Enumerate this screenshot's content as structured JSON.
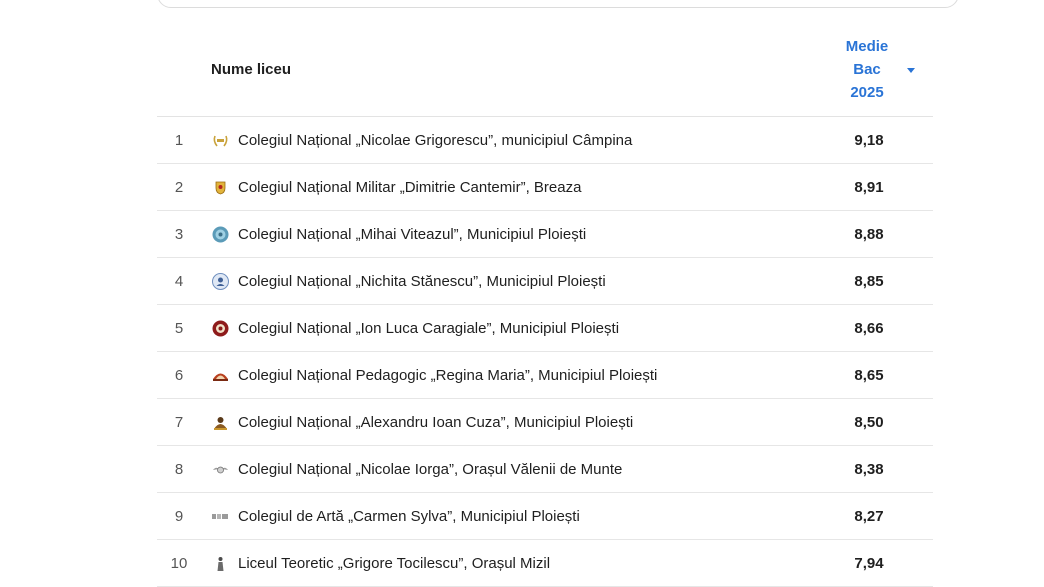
{
  "table": {
    "header": {
      "name_label": "Nume liceu",
      "score_label_line1": "Medie",
      "score_label_line2": "Bac",
      "score_label_line3": "2025"
    },
    "rows": [
      {
        "rank": "1",
        "name": "Colegiul Național „Nicolae Grigorescu”, municipiul Câmpina",
        "score": "9,18",
        "logo": "laurel-crest-icon"
      },
      {
        "rank": "2",
        "name": "Colegiul Național Militar „Dimitrie Cantemir”, Breaza",
        "score": "8,91",
        "logo": "military-shield-icon"
      },
      {
        "rank": "3",
        "name": "Colegiul Național „Mihai Viteazul”, Municipiul Ploiești",
        "score": "8,88",
        "logo": "round-seal-icon"
      },
      {
        "rank": "4",
        "name": "Colegiul Național „Nichita Stănescu”, Municipiul Ploiești",
        "score": "8,85",
        "logo": "portrait-seal-icon"
      },
      {
        "rank": "5",
        "name": "Colegiul Național „Ion Luca Caragiale”, Municipiul Ploiești",
        "score": "8,66",
        "logo": "red-crest-icon"
      },
      {
        "rank": "6",
        "name": "Colegiul Național Pedagogic „Regina Maria”, Municipiul Ploiești",
        "score": "8,65",
        "logo": "crown-arch-icon"
      },
      {
        "rank": "7",
        "name": "Colegiul Național „Alexandru Ioan Cuza”, Municipiul Ploiești",
        "score": "8,50",
        "logo": "bust-icon"
      },
      {
        "rank": "8",
        "name": "Colegiul Național „Nicolae Iorga”, Orașul Vălenii de Munte",
        "score": "8,38",
        "logo": "winged-emblem-icon"
      },
      {
        "rank": "9",
        "name": "Colegiul de Artă „Carmen Sylva”, Municipiul Ploiești",
        "score": "8,27",
        "logo": "text-logo-icon"
      },
      {
        "rank": "10",
        "name": "Liceul Teoretic „Grigore Tocilescu”, Orașul Mizil",
        "score": "7,94",
        "logo": "figure-icon"
      }
    ]
  },
  "colors": {
    "accent": "#2a74d6",
    "row_divider": "#e6e6e6"
  }
}
